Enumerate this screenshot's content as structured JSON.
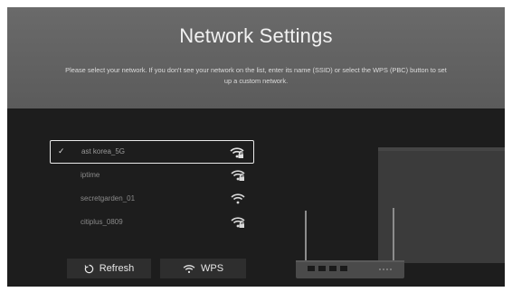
{
  "header": {
    "title": "Network Settings",
    "description": "Please select your network. If you don't see your network on the list, enter its name (SSID) or select the WPS (PBC) button to set up a custom network."
  },
  "networks": [
    {
      "name": "ast korea_5G",
      "selected": true,
      "secured": true,
      "icon": "wifi-lock-icon"
    },
    {
      "name": "iptime",
      "selected": false,
      "secured": true,
      "icon": "wifi-lock-icon"
    },
    {
      "name": "secretgarden_01",
      "selected": false,
      "secured": false,
      "icon": "wifi-icon"
    },
    {
      "name": "citiplus_0809",
      "selected": false,
      "secured": true,
      "icon": "wifi-lock-icon"
    }
  ],
  "buttons": {
    "refresh_label": "Refresh",
    "wps_label": "WPS"
  },
  "colors": {
    "header_bg": "#5f5f5f",
    "screen_bg": "#1d1d1d",
    "button_bg": "#2e2e2e",
    "selection_border": "#eaeaea"
  }
}
